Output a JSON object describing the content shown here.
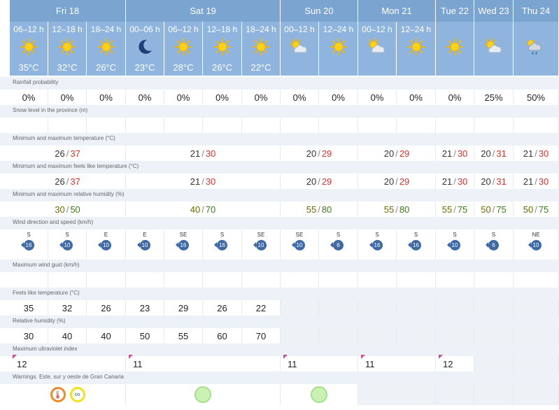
{
  "days": [
    {
      "label": "Fri 18"
    },
    {
      "label": "Sat 19"
    },
    {
      "label": "Sun 20"
    },
    {
      "label": "Mon 21"
    },
    {
      "label": "Tue 22"
    },
    {
      "label": "Wed 23"
    },
    {
      "label": "Thu 24"
    }
  ],
  "periods": [
    {
      "label": "06–12 h",
      "temp": "35°C",
      "icon": "sun-icon"
    },
    {
      "label": "12–18 h",
      "temp": "32°C",
      "icon": "sun-icon"
    },
    {
      "label": "18–24 h",
      "temp": "26°C",
      "icon": "sun-icon"
    },
    {
      "label": "00–06 h",
      "temp": "23°C",
      "icon": "moon-icon"
    },
    {
      "label": "06–12 h",
      "temp": "28°C",
      "icon": "sun-icon"
    },
    {
      "label": "12–18 h",
      "temp": "26°C",
      "icon": "sun-icon"
    },
    {
      "label": "18–24 h",
      "temp": "22°C",
      "icon": "sun-icon"
    },
    {
      "label": "00–12 h",
      "temp": "",
      "icon": "sun-cloud-icon"
    },
    {
      "label": "12–24 h",
      "temp": "",
      "icon": "sun-icon"
    },
    {
      "label": "00–12 h",
      "temp": "",
      "icon": "sun-cloud-icon"
    },
    {
      "label": "12–24 h",
      "temp": "",
      "icon": "sun-icon"
    },
    {
      "label": "",
      "temp": "",
      "icon": "sun-icon"
    },
    {
      "label": "",
      "temp": "",
      "icon": "sun-cloud-icon"
    },
    {
      "label": "",
      "temp": "",
      "icon": "cloud-rain-icon"
    }
  ],
  "sections": {
    "rainfall": "Rainfall probability",
    "snow": "Snow level in the province (m)",
    "temp": "Minimum and maximum temperature (°C)",
    "feels_minmax": "Minimum and maximum feels like temperature (°C)",
    "humidity_minmax": "Minimum and maximum relative humidity (%)",
    "wind": "Wind direction and speed (km/h)",
    "gust": "Maximum wind gust (km/h)",
    "feels": "Feels like temperature (°C)",
    "humidity": "Relative humidity (%)",
    "uv": "Maximum ultraviolet index",
    "warnings": "Warnings. Este, sur y oeste de Gran Canaria"
  },
  "rainfall": [
    "0%",
    "0%",
    "0%",
    "0%",
    "0%",
    "0%",
    "0%",
    "0%",
    "0%",
    "0%",
    "0%",
    "0%",
    "25%",
    "50%"
  ],
  "temp_minmax": [
    {
      "min": "26",
      "max": "37"
    },
    {
      "min": "21",
      "max": "30"
    },
    {
      "min": "20",
      "max": "29"
    },
    {
      "min": "20",
      "max": "29"
    },
    {
      "min": "21",
      "max": "30"
    },
    {
      "min": "20",
      "max": "31"
    },
    {
      "min": "21",
      "max": "30"
    }
  ],
  "feels_minmax": [
    {
      "min": "26",
      "max": "37"
    },
    {
      "min": "21",
      "max": "30"
    },
    {
      "min": "20",
      "max": "29"
    },
    {
      "min": "20",
      "max": "29"
    },
    {
      "min": "21",
      "max": "30"
    },
    {
      "min": "20",
      "max": "31"
    },
    {
      "min": "21",
      "max": "30"
    }
  ],
  "humidity_minmax": [
    {
      "min": "30",
      "max": "50"
    },
    {
      "min": "40",
      "max": "70"
    },
    {
      "min": "55",
      "max": "80"
    },
    {
      "min": "55",
      "max": "80"
    },
    {
      "min": "55",
      "max": "75"
    },
    {
      "min": "50",
      "max": "75"
    },
    {
      "min": "50",
      "max": "75"
    }
  ],
  "wind": [
    {
      "dir": "S",
      "speed": "16"
    },
    {
      "dir": "S",
      "speed": "10"
    },
    {
      "dir": "E",
      "speed": "10"
    },
    {
      "dir": "E",
      "speed": "10"
    },
    {
      "dir": "SE",
      "speed": "16"
    },
    {
      "dir": "S",
      "speed": "16"
    },
    {
      "dir": "SE",
      "speed": "10"
    },
    {
      "dir": "SE",
      "speed": "10"
    },
    {
      "dir": "S",
      "speed": "6"
    },
    {
      "dir": "S",
      "speed": "16"
    },
    {
      "dir": "S",
      "speed": "16"
    },
    {
      "dir": "S",
      "speed": "10"
    },
    {
      "dir": "S",
      "speed": "6"
    },
    {
      "dir": "NE",
      "speed": "10"
    }
  ],
  "feels": [
    "35",
    "32",
    "26",
    "23",
    "29",
    "26",
    "22"
  ],
  "humidity": [
    "30",
    "40",
    "40",
    "50",
    "55",
    "60",
    "70"
  ],
  "uv": [
    "12",
    "11",
    "11",
    "11",
    "12"
  ],
  "colors": {
    "header_dark": "#7ba4d0",
    "header_light": "#8fb5de",
    "section_bg": "#edf2f8",
    "max": "#d8322d",
    "wind": "#3d6aa6"
  }
}
